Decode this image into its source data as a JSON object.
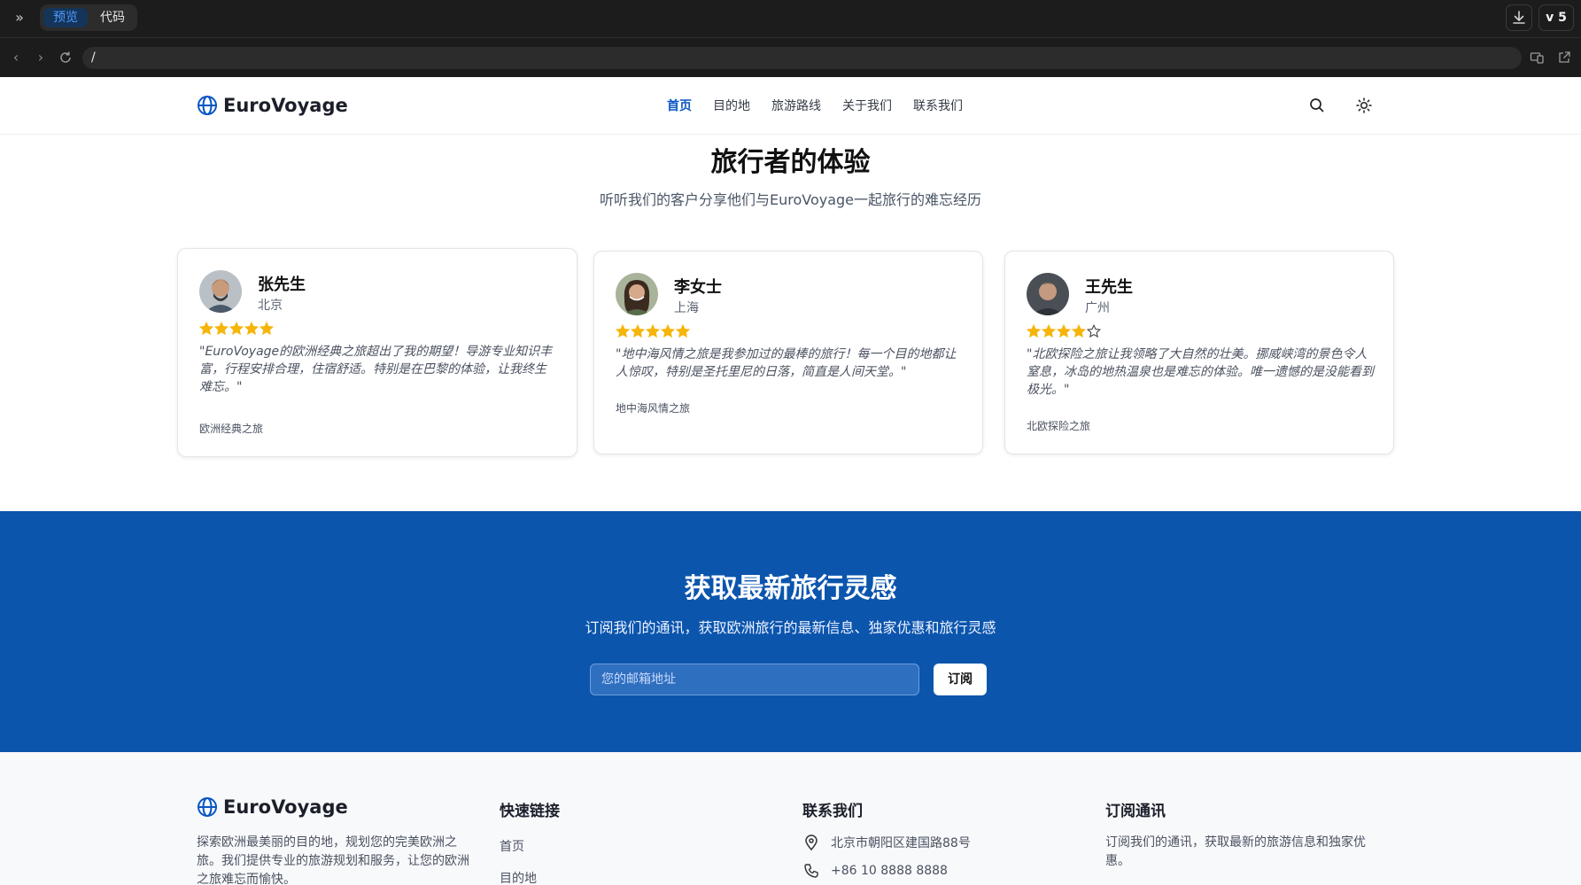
{
  "app_bar": {
    "tabs": [
      {
        "label": "预览",
        "active": true
      },
      {
        "label": "代码",
        "active": false
      }
    ],
    "version_label": "v 5"
  },
  "address_bar": {
    "url": "/"
  },
  "site": {
    "brand": "EuroVoyage",
    "nav": [
      {
        "label": "首页",
        "active": true
      },
      {
        "label": "目的地",
        "active": false
      },
      {
        "label": "旅游路线",
        "active": false
      },
      {
        "label": "关于我们",
        "active": false
      },
      {
        "label": "联系我们",
        "active": false
      }
    ]
  },
  "testimonials": {
    "title": "旅行者的体验",
    "subtitle": "听听我们的客户分享他们与EuroVoyage一起旅行的难忘经历",
    "items": [
      {
        "name": "张先生",
        "city": "北京",
        "rating": 5,
        "quote": "\"EuroVoyage的欧洲经典之旅超出了我的期望！导游专业知识丰富，行程安排合理，住宿舒适。特别是在巴黎的体验，让我终生难忘。\"",
        "trip": "欧洲经典之旅"
      },
      {
        "name": "李女士",
        "city": "上海",
        "rating": 5,
        "quote": "\"地中海风情之旅是我参加过的最棒的旅行！每一个目的地都让人惊叹，特别是圣托里尼的日落，简直是人间天堂。\"",
        "trip": "地中海风情之旅"
      },
      {
        "name": "王先生",
        "city": "广州",
        "rating": 4,
        "quote": "\"北欧探险之旅让我领略了大自然的壮美。挪威峡湾的景色令人窒息，冰岛的地热温泉也是难忘的体验。唯一遗憾的是没能看到极光。\"",
        "trip": "北欧探险之旅"
      }
    ]
  },
  "newsletter": {
    "title": "获取最新旅行灵感",
    "subtitle": "订阅我们的通讯，获取欧洲旅行的最新信息、独家优惠和旅行灵感",
    "email_placeholder": "您的邮箱地址",
    "button_label": "订阅"
  },
  "footer": {
    "brand": "EuroVoyage",
    "description": "探索欧洲最美丽的目的地，规划您的完美欧洲之旅。我们提供专业的旅游规划和服务，让您的欧洲之旅难忘而愉快。",
    "quick_links_heading": "快速链接",
    "quick_links": [
      "首页",
      "目的地"
    ],
    "contact_heading": "联系我们",
    "address": "北京市朝阳区建国路88号",
    "phone": "+86 10 8888 8888",
    "newsletter_heading": "订阅通讯",
    "newsletter_desc": "订阅我们的通讯，获取最新的旅游信息和独家优惠。"
  },
  "colors": {
    "brand_blue": "#0b55ad",
    "star_gold": "#f5b50a",
    "nav_active": "#0a56c4"
  }
}
